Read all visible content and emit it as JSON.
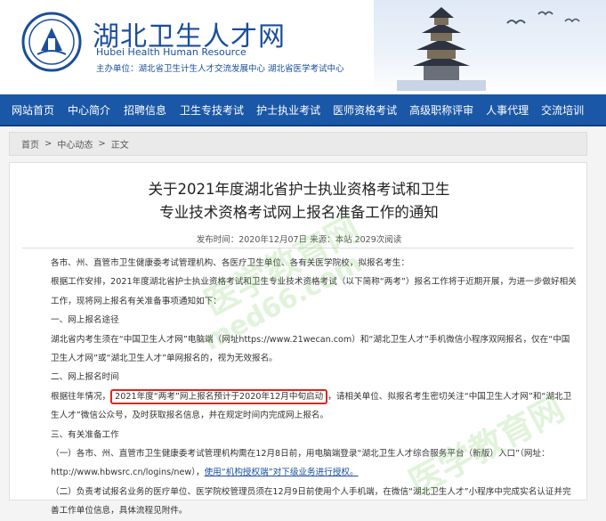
{
  "header": {
    "title": "湖北卫生人才网",
    "subtitle_en": "Hubei Health Human Resource",
    "org": "主办单位：湖北省卫生计生人才交流发展中心  湖北省医学考试中心"
  },
  "nav": {
    "items": [
      "网站首页",
      "中心简介",
      "招聘信息",
      "卫生专技考试",
      "护士执业考试",
      "医师资格考试",
      "高级职称评审",
      "人事代理",
      "交流培训"
    ]
  },
  "breadcrumb": {
    "home": "首页",
    "sep1": ">",
    "section": "中心动态",
    "sep2": ">",
    "current": "正文"
  },
  "article": {
    "title_line1": "关于2021年度湖北省护士执业资格考试和卫生",
    "title_line2": "专业技术资格考试网上报名准备工作的通知",
    "meta": "发布时间：2020年12月07日 来源：本站 2029次阅读",
    "p1": "各市、州、直管市卫生健康委考试管理机构、各医疗卫生单位、各有关医学院校，拟报名考生：",
    "p2": "根据工作安排，2021年度湖北省护士执业资格考试和卫生专业技术资格考试（以下简称“两考”）报名工作将于近期开展，为进一步做好相关工作，现将网上报名有关准备事项通知如下：",
    "h1": "一、网上报名途径",
    "p3": "湖北省内考生须在“中国卫生人才网”电脑端（网址https://www.21wecan.com）和“湖北卫生人才”手机微信小程序双网报名，仅在“中国卫生人才网”或“湖北卫生人才”单网报名的，视为无效报名。",
    "h2": "二、网上报名时间",
    "p4_pre": "根据往年情况，",
    "p4_highlight": "2021年度“两考”网上报名预计于2020年12月中旬启动",
    "p4_post": "，请相关单位、拟报名考生密切关注“中国卫生人才网”和“湖北卫生人才”微信公众号，及时获取报名信息，并在规定时间内完成网上报名。",
    "h3": "三、有关准备工作",
    "p5": "（一）各市、州、直管市卫生健康委考试管理机构需在12月8日前，用电脑端登录“湖北卫生人才综合服务平台（新版）入口”（网址：http://www.hbwsrc.cn/logins/new），",
    "p5_link": "使用“机构授权端”对下级业务进行授权。",
    "p6": "（二）负责考试报名业务的医疗单位、医学院校管理员须在12月9日前使用个人手机端，在微信“湖北卫生人才”小程序中完成实名认证并完善工作单位信息，具体流程见附件。"
  },
  "watermarks": [
    "医学教育网",
    "med66.com",
    "医学教育网"
  ],
  "colors": {
    "nav_bg": "#1a57a7",
    "title_blue": "#1a4f9a",
    "highlight_border": "#e3241b"
  }
}
